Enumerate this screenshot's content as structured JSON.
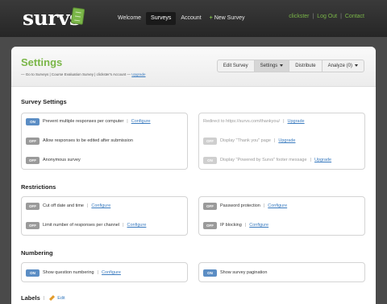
{
  "app": {
    "logo": "survs"
  },
  "nav": {
    "welcome": "Welcome",
    "surveys": "Surveys",
    "account": "Account",
    "new_survey": "New Survey",
    "plus": "+"
  },
  "user": {
    "name": "clickster",
    "sep": "|",
    "logout": "Log Out",
    "contact": "Contact"
  },
  "page": {
    "title": "Settings",
    "breadcrumb": {
      "prefix": "— Go to Surveys | Course Evaluation Survey | clickster's Account —",
      "upgrade": "Upgrade"
    }
  },
  "tabs": {
    "edit": "Edit Survey",
    "settings": "Settings",
    "distribute": "Distribute",
    "analyze": "Analyze (0)"
  },
  "sections": {
    "survey_settings": "Survey Settings",
    "restrictions": "Restrictions",
    "numbering": "Numbering",
    "labels": "Labels",
    "labels_sep": "|",
    "labels_edit": "Edit"
  },
  "sep": "|",
  "survey_left": [
    {
      "toggle": "ON",
      "text": "Prevent multiple responses per computer",
      "link": "Configure"
    },
    {
      "toggle": "OFF",
      "text": "Allow responses to be edited after submission"
    },
    {
      "toggle": "OFF",
      "text": "Anonymous survey"
    }
  ],
  "survey_right": [
    {
      "text": "Redirect to https://survs.com/thankyou/",
      "link": "Upgrade"
    },
    {
      "toggle": "OFF",
      "text": "Display \"Thank you\" page",
      "link": "Upgrade"
    },
    {
      "toggle": "ON",
      "text": "Display \"Powered by Survs\" footer message",
      "link": "Upgrade"
    }
  ],
  "restrict_left": [
    {
      "toggle": "OFF",
      "text": "Cut off date and time",
      "link": "Configure"
    },
    {
      "toggle": "OFF",
      "text": "Limit number of responses per channel",
      "link": "Configure"
    }
  ],
  "restrict_right": [
    {
      "toggle": "OFF",
      "text": "Password protection",
      "link": "Configure"
    },
    {
      "toggle": "OFF",
      "text": "IP blocking",
      "link": "Configure"
    }
  ],
  "numbering_left": {
    "toggle": "ON",
    "text": "Show question numbering",
    "link": "Configure"
  },
  "numbering_right": {
    "toggle": "ON",
    "text": "Show survey pagination"
  },
  "colors": {
    "accent": "#7ab648",
    "toggle_on": "#5b8dc4",
    "toggle_off": "#9a9a9a",
    "link": "#3a7bbf"
  }
}
